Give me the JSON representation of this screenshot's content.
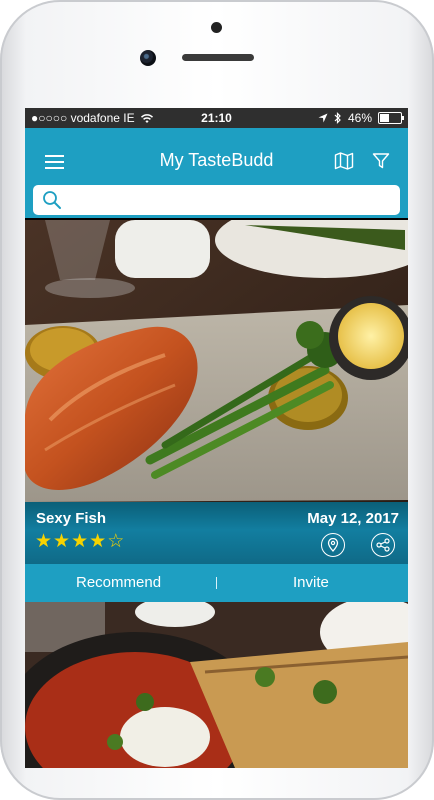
{
  "status_bar": {
    "carrier": "●○○○○ vodafone IE",
    "time": "21:10",
    "battery": "46%",
    "battery_level": 0.46
  },
  "header": {
    "title": "My TasteBudd"
  },
  "search": {
    "placeholder": "",
    "value": ""
  },
  "card": {
    "name": "Sexy Fish",
    "date": "May 12, 2017",
    "rating": 4,
    "rating_max": 5,
    "stars": [
      "★",
      "★",
      "★",
      "★",
      "☆"
    ]
  },
  "actions": {
    "recommend": "Recommend",
    "invite": "Invite"
  },
  "colors": {
    "primary": "#1e9fc2",
    "star": "#f7d300",
    "status_bar": "#2f2f2f"
  },
  "icons": [
    "menu-icon",
    "map-icon",
    "filter-icon",
    "search-icon",
    "location-pin-icon",
    "share-icon",
    "wifi-icon",
    "bluetooth-icon",
    "location-arrow-icon",
    "battery-icon"
  ]
}
